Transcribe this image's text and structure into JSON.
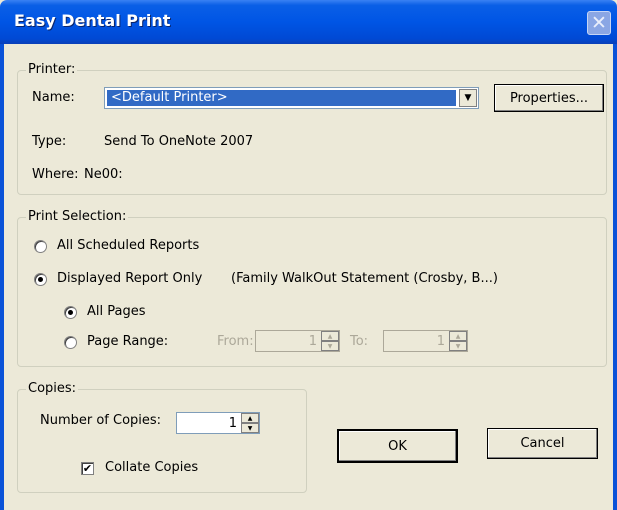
{
  "window": {
    "title": "Easy Dental Print",
    "close_glyph": "✕"
  },
  "printer": {
    "legend": "Printer:",
    "name_label": "Name:",
    "name_value": "<Default Printer>",
    "dropdown_glyph": "▼",
    "properties_label": "Properties...",
    "type_label": "Type:",
    "type_value": "Send To OneNote 2007",
    "where_label": "Where:",
    "where_value": "Ne00:"
  },
  "print_selection": {
    "legend": "Print Selection:",
    "all_scheduled_label": "All Scheduled Reports",
    "displayed_only_label": "Displayed Report Only",
    "displayed_report_desc": "(Family WalkOut Statement (Crosby, B...)",
    "all_pages_label": "All Pages",
    "page_range_label": "Page Range:",
    "from_label": "From:",
    "from_value": "1",
    "to_label": "To:",
    "to_value": "1",
    "selected": "displayed_only",
    "page_option": "all_pages"
  },
  "copies": {
    "legend": "Copies:",
    "number_label": "Number of Copies:",
    "number_value": "1",
    "collate_label": "Collate Copies",
    "collate_checked": true,
    "check_glyph": "✔"
  },
  "buttons": {
    "ok_label": "OK",
    "cancel_label": "Cancel"
  },
  "spinner": {
    "up_glyph": "▲",
    "down_glyph": "▼"
  }
}
